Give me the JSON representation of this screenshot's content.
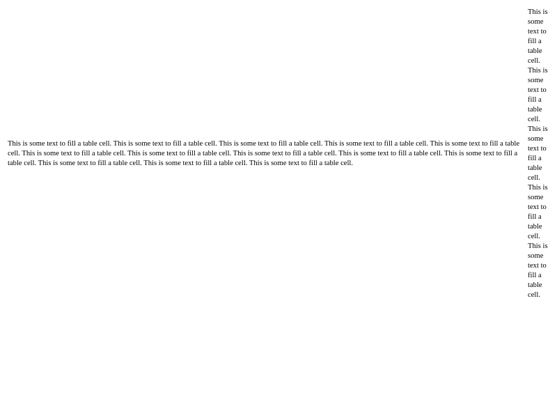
{
  "table": {
    "wide_cell_text": "This is some text to fill a table cell. This is some text to fill a table cell. This is some text to fill a table cell. This is some text to fill a table cell. This is some text to fill a table cell. This is some text to fill a table cell. This is some text to fill a table cell. This is some text to fill a table cell. This is some text to fill a table cell. This is some text to fill a table cell. This is some text to fill a table cell. This is some text to fill a table cell. This is some text to fill a table cell.",
    "narrow_cell_text": "This is some text to fill a table cell. This is some text to fill a table cell. This is some text to fill a table cell. This is some text to fill a table cell. This is some text to fill a table cell."
  }
}
